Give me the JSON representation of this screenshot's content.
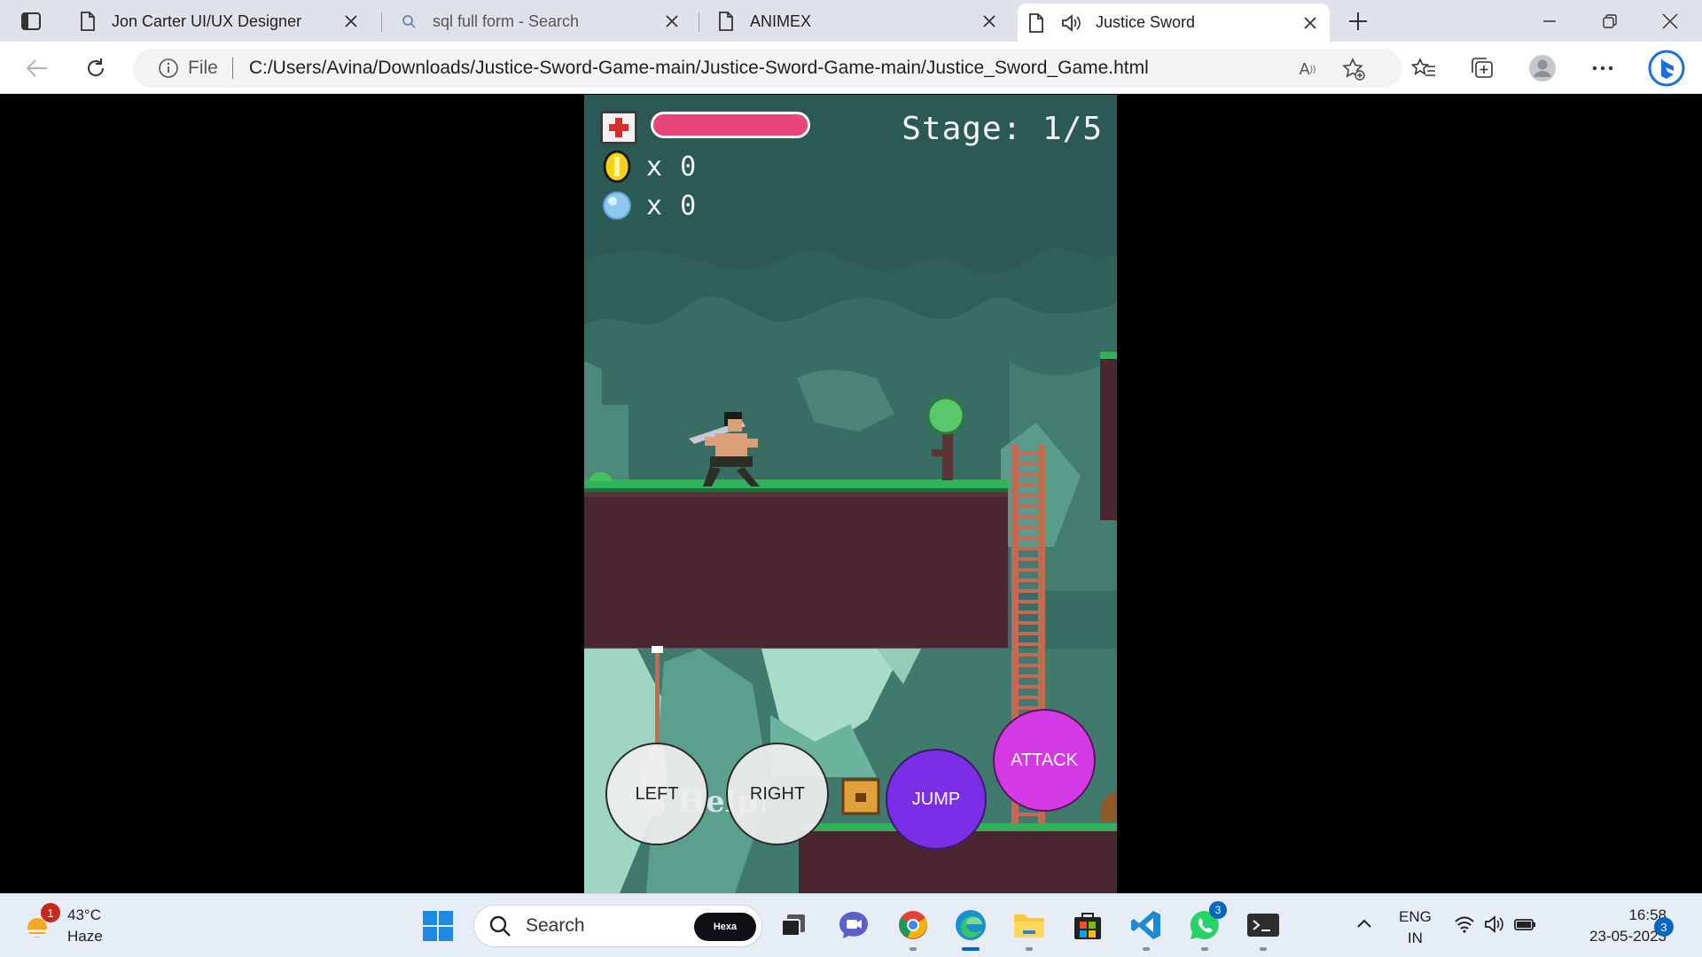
{
  "browser": {
    "tabs": [
      {
        "label": "Jon Carter UI/UX Designer",
        "icon": "page-icon"
      },
      {
        "label": "sql full form - Search",
        "icon": "search-icon"
      },
      {
        "label": "ANIMEX",
        "icon": "page-icon"
      },
      {
        "label": "Justice Sword",
        "icon": "page-icon",
        "audio": true,
        "active": true
      }
    ],
    "address": {
      "scheme_label": "File",
      "url": "C:/Users/Avina/Downloads/Justice-Sword-Game-main/Justice-Sword-Game-main/Justice_Sword_Game.html"
    }
  },
  "game": {
    "hud": {
      "stage_label": "Stage: 1/5",
      "coins_x": "x",
      "coins_count": "0",
      "gems_x": "x",
      "gems_count": "0",
      "health_fraction": 1.0
    },
    "controls": {
      "left": "LEFT",
      "right": "RIGHT",
      "jump": "JUMP",
      "attack": "ATTACK"
    },
    "help_text": "Help!"
  },
  "taskbar": {
    "weather": {
      "temp": "43°C",
      "condition": "Haze",
      "badge": "1"
    },
    "search_label": "Search",
    "search_badge": "Hexa",
    "whatsapp_badge": "3",
    "lang_top": "ENG",
    "lang_bottom": "IN",
    "time": "16:58",
    "date": "23-05-2023",
    "notifications": "3"
  },
  "colors": {
    "health_bar": "#e8457d",
    "jump_button": "#7a2ee6",
    "attack_button": "#d43ae3",
    "edge_accent": "#0067c0"
  }
}
